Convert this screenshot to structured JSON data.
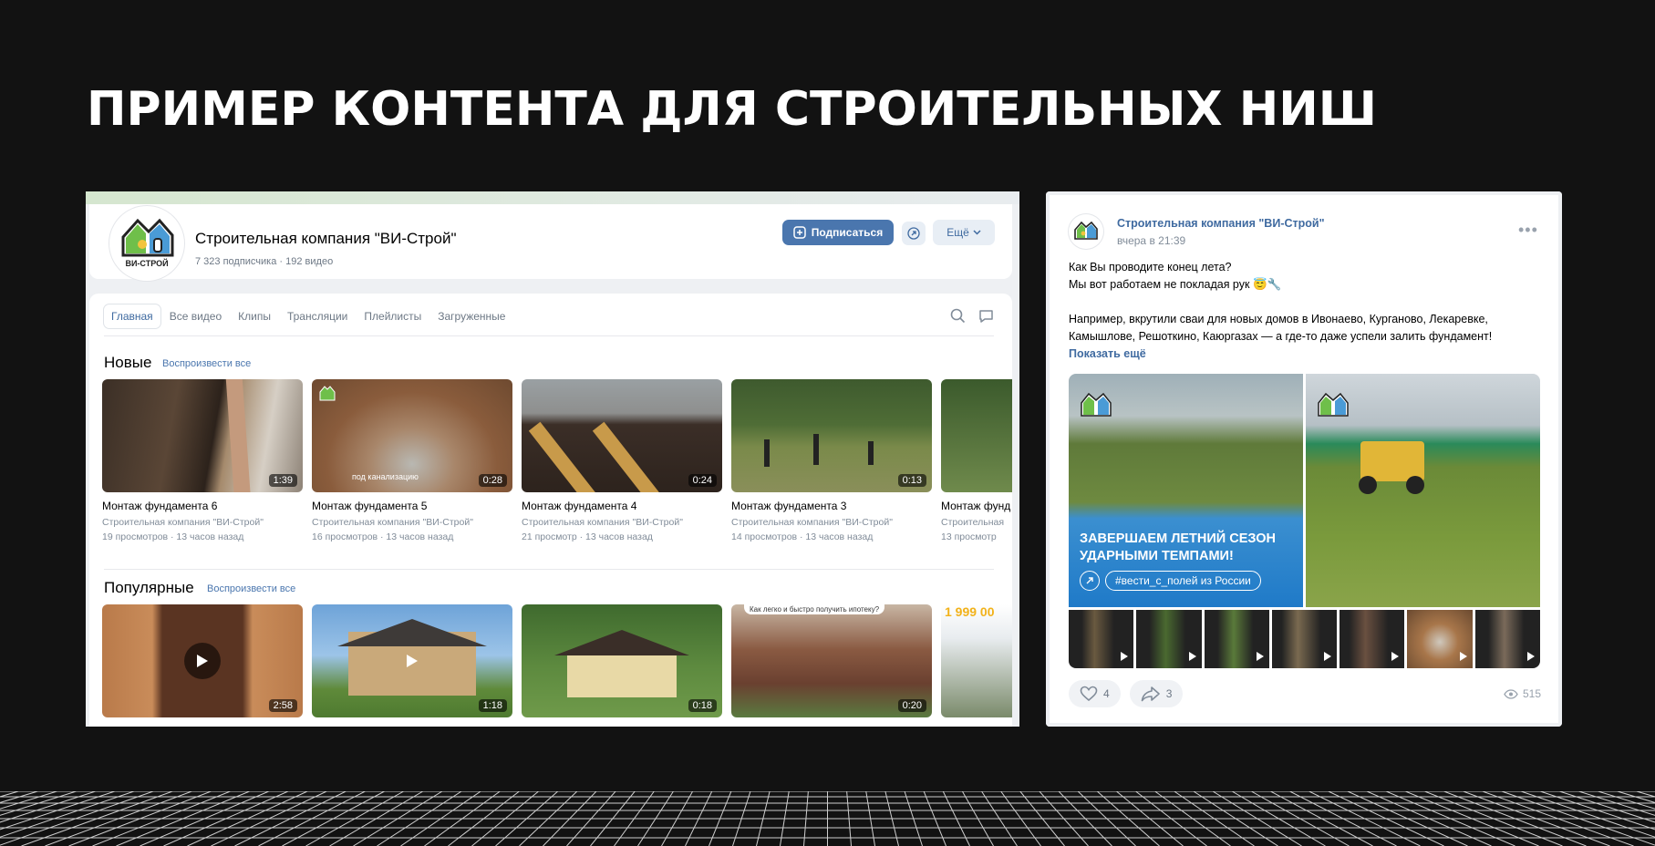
{
  "slide": {
    "headline": "ПРИМЕР КОНТЕНТА ДЛЯ СТРОИТЕЛЬНЫХ НИШ"
  },
  "channel": {
    "logo_text": "ВИ-СТРОЙ",
    "name": "Строительная компания \"ВИ-Строй\"",
    "meta": "7 323 подписчика · 192 видео",
    "subscribe_label": "Подписаться",
    "more_label": "Ещё",
    "tabs": [
      {
        "label": "Главная",
        "active": true
      },
      {
        "label": "Все видео",
        "active": false
      },
      {
        "label": "Клипы",
        "active": false
      },
      {
        "label": "Трансляции",
        "active": false
      },
      {
        "label": "Плейлисты",
        "active": false
      },
      {
        "label": "Загруженные",
        "active": false
      }
    ],
    "sections": [
      {
        "title": "Новые",
        "play_all": "Воспроизвести все",
        "videos": [
          {
            "title": "Монтаж фундамента 6",
            "author": "Строительная компания \"ВИ-Строй\"",
            "stats": "19 просмотров · 13 часов назад",
            "duration": "1:39",
            "overlay": ""
          },
          {
            "title": "Монтаж фундамента 5",
            "author": "Строительная компания \"ВИ-Строй\"",
            "stats": "16 просмотров · 13 часов назад",
            "duration": "0:28",
            "overlay": "под канализацию"
          },
          {
            "title": "Монтаж фундамента 4",
            "author": "Строительная компания \"ВИ-Строй\"",
            "stats": "21 просмотр · 13 часов назад",
            "duration": "0:24",
            "overlay": ""
          },
          {
            "title": "Монтаж фундамента 3",
            "author": "Строительная компания \"ВИ-Строй\"",
            "stats": "14 просмотров · 13 часов назад",
            "duration": "0:13",
            "overlay": ""
          },
          {
            "title": "Монтаж фунд",
            "author": "Строительная",
            "stats": "13 просмотр",
            "duration": "",
            "overlay": ""
          }
        ]
      },
      {
        "title": "Популярные",
        "play_all": "Воспроизвести все",
        "videos": [
          {
            "duration": "2:58",
            "overlay": ""
          },
          {
            "duration": "1:18",
            "overlay": ""
          },
          {
            "duration": "0:18",
            "overlay": ""
          },
          {
            "duration": "0:20",
            "overlay": "Как легко и быстро получить ипотеку?"
          },
          {
            "duration": "",
            "overlay": "1 999 00"
          }
        ]
      }
    ]
  },
  "post": {
    "author": "Строительная компания \"ВИ-Строй\"",
    "time": "вчера в 21:39",
    "line1": "Как Вы проводите конец лета?",
    "line2": "Мы вот работаем не покладая рук",
    "line3": "Например, вкрутили сваи для новых домов в Ивонаево, Курганово, Лекаревке,",
    "line4": "Камышлове, Решоткино, Каюргазах — а где-то даже успели залить фундамент!",
    "show_more": "Показать ещё",
    "banner_line1": "ЗАВЕРШАЕМ ЛЕТНИЙ СЕЗОН",
    "banner_line2": "УДАРНЫМИ ТЕМПАМИ!",
    "hashtag": "#вести_с_полей из России",
    "likes": "4",
    "shares": "3",
    "views": "515"
  }
}
